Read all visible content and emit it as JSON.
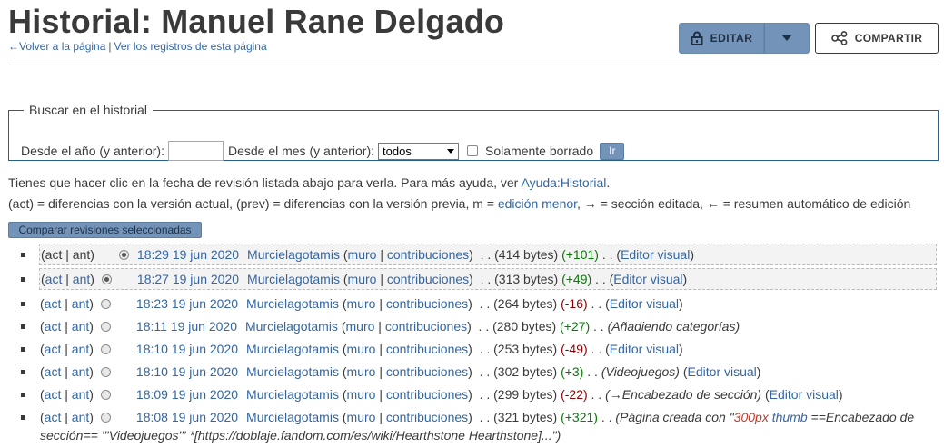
{
  "header": {
    "title": "Historial: Manuel Rane Delgado",
    "back_link": "Volver a la página",
    "logs_link": "Ver los registros de esta página",
    "edit_label": "EDITAR",
    "share_label": "COMPARTIR"
  },
  "search": {
    "legend": "Buscar en el historial",
    "year_label": "Desde el año (y anterior):",
    "year_value": "",
    "month_label": "Desde el mes (y anterior):",
    "month_selected": "todos",
    "deleted_label": "Solamente borrado",
    "go_label": "Ir"
  },
  "help": {
    "text": "Tienes que hacer clic en la fecha de revisión listada abajo para verla. Para más ayuda, ver",
    "link": "Ayuda:Historial",
    "end": "."
  },
  "legend": {
    "part1": "(act) = diferencias con la versión actual, (prev) = diferencias con la versión previa, m =",
    "minor_link": "edición menor",
    "part2": ", → = sección editada, ← = resumen automático de edición"
  },
  "compare_button": "Comparar revisiones seleccionadas",
  "common": {
    "act": "act",
    "ant": "ant",
    "user": "Murcielagotamis",
    "talk": "muro",
    "contribs": "contribuciones",
    "visual": "Editor visual"
  },
  "revisions": [
    {
      "date": "18:29 19 jun 2020",
      "size": "(414 bytes)",
      "diff": "(+101)"
    },
    {
      "date": "18:27 19 jun 2020",
      "size": "(313 bytes)",
      "diff": "(+49)"
    },
    {
      "date": "18:23 19 jun 2020",
      "size": "(264 bytes)",
      "diff": "(-16)"
    },
    {
      "date": "18:11 19 jun 2020",
      "size": "(280 bytes)",
      "diff": "(+27)",
      "summary": "(Añadiendo categorías)"
    },
    {
      "date": "18:10 19 jun 2020",
      "size": "(253 bytes)",
      "diff": "(-49)"
    },
    {
      "date": "18:10 19 jun 2020",
      "size": "(302 bytes)",
      "diff": "(+3)",
      "summary": "(Videojuegos)"
    },
    {
      "date": "18:09 19 jun 2020",
      "size": "(299 bytes)",
      "diff": "(-22)",
      "summary": "(→Encabezado de sección)"
    },
    {
      "date": "18:08 19 jun 2020",
      "size": "(321 bytes)",
      "diff": "(+321)",
      "summary_a": "(Página creada con \"",
      "summary_red1": "300px",
      "summary_b": " ",
      "summary_red2": "thumb",
      "summary_c": " ==Encabezado de",
      "summary_line2": "sección== '''Videojuegos''' *[https://doblaje.fandom.com/es/wiki/Hearthstone Hearthstone]...\")"
    }
  ],
  "colors": {
    "accent": "#7393b8",
    "link": "#3366a3",
    "positive": "#0a7a0a",
    "negative": "#8b0000"
  }
}
